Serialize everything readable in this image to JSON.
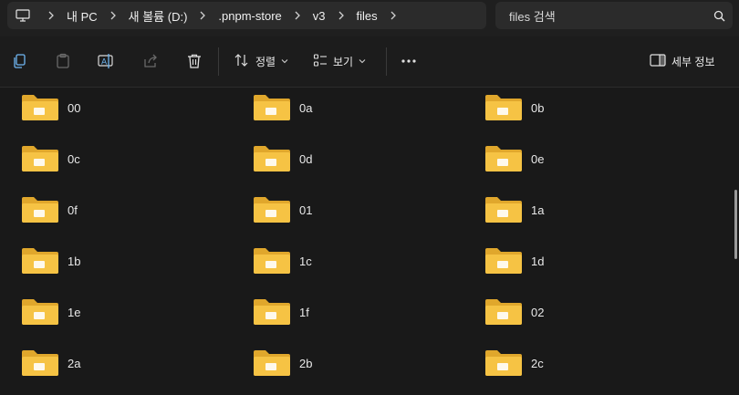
{
  "breadcrumb": {
    "pc_label": "내 PC",
    "drive_label": "새 볼륨 (D:)",
    "store_label": ".pnpm-store",
    "v3_label": "v3",
    "files_label": "files"
  },
  "search": {
    "text": "files 검색"
  },
  "toolbar": {
    "sort_label": "정렬",
    "view_label": "보기",
    "details_label": "세부 정보"
  },
  "folders": [
    "00",
    "0a",
    "0b",
    "0c",
    "0d",
    "0e",
    "0f",
    "01",
    "1a",
    "1b",
    "1c",
    "1d",
    "1e",
    "1f",
    "02",
    "2a",
    "2b",
    "2c"
  ],
  "colors": {
    "folder_front": "#f6c344",
    "folder_back": "#e0a72c",
    "background": "#191919"
  }
}
